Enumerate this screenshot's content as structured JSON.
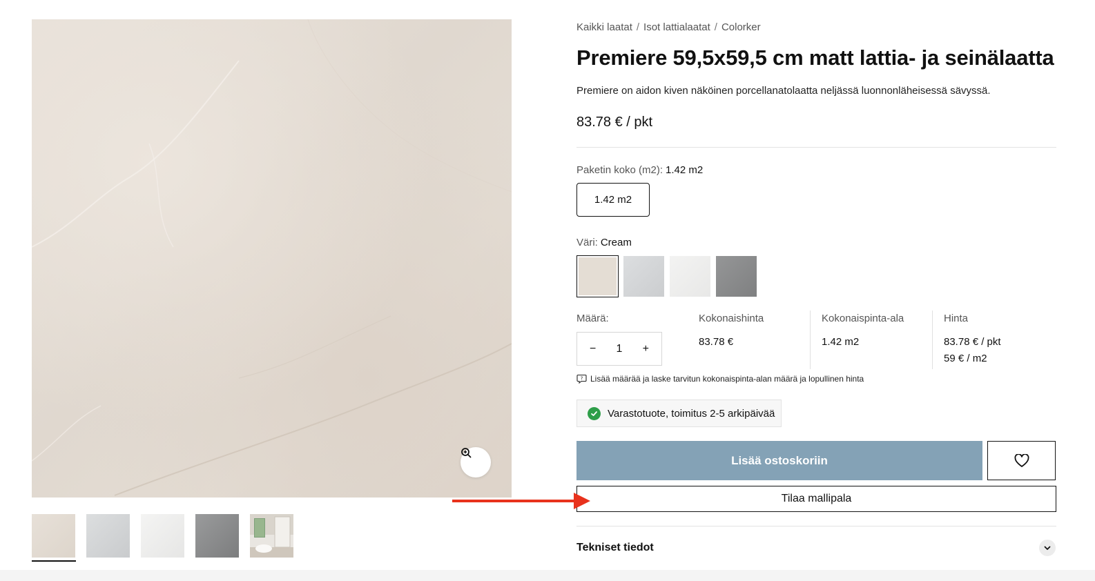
{
  "breadcrumb": [
    "Kaikki laatat",
    "Isot lattialaatat",
    "Colorker"
  ],
  "breadcrumb_separator": "/",
  "product": {
    "title": "Premiere 59,5x59,5 cm matt lattia- ja seinälaatta",
    "description": "Premiere on aidon kiven näköinen porcellanatolaatta neljässä luonnonläheisessä sävyssä.",
    "price": "83.78 € / pkt"
  },
  "package": {
    "label": "Paketin koko (m2):",
    "selected": "1.42 m2",
    "options": [
      "1.42 m2"
    ]
  },
  "color": {
    "label": "Väri:",
    "selected": "Cream",
    "swatches": [
      {
        "name": "cream",
        "hex": "#e4ddd4"
      },
      {
        "name": "light-grey",
        "hex": "#d4d6d8"
      },
      {
        "name": "white",
        "hex": "#eeeeed"
      },
      {
        "name": "grey",
        "hex": "#8c8d8e"
      }
    ]
  },
  "quantity": {
    "label": "Määrä:",
    "value": "1",
    "minus": "−",
    "plus": "+"
  },
  "summary": {
    "total_price_label": "Kokonaishinta",
    "total_price": "83.78 €",
    "total_area_label": "Kokonaispinta-ala",
    "total_area": "1.42 m2",
    "price_label": "Hinta",
    "price_per_package": "83.78 € / pkt",
    "price_per_m2": "59 € / m2"
  },
  "hint": "Lisää määrää ja laske tarvitun kokonaispinta-alan määrä ja lopullinen hinta",
  "stock": "Varastotuote, toimitus 2-5 arkipäivää",
  "buttons": {
    "add_to_cart": "Lisää ostoskoriin",
    "order_sample": "Tilaa mallipala"
  },
  "accordion": {
    "technical": "Tekniset tiedot"
  },
  "gallery": {
    "thumbnails": [
      "cream",
      "light-grey",
      "white",
      "grey",
      "bathroom-scene"
    ]
  },
  "colors": {
    "accent_button": "#84a2b6",
    "arrow": "#e8321c",
    "stock_check": "#2e9e49"
  }
}
